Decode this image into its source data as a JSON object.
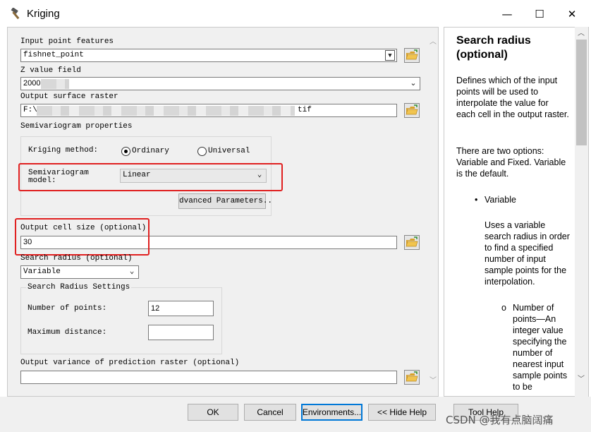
{
  "window": {
    "title": "Kriging",
    "minimize_glyph": "—",
    "maximize_glyph": "☐",
    "close_glyph": "✕"
  },
  "form": {
    "input_point_features": {
      "label": "Input point features",
      "value": "fishnet_point"
    },
    "z_value_field": {
      "label": "Z value field",
      "value": "2000"
    },
    "output_surface_raster": {
      "label": "Output surface raster",
      "value_prefix": "F:\\",
      "value_suffix": "tif"
    },
    "semivariogram_properties": {
      "label": "Semivariogram properties",
      "kriging_method_label": "Kriging method:",
      "ordinary_label": "Ordinary",
      "universal_label": "Universal",
      "selected_method": "Ordinary",
      "model_label_line1": "Semivariogram",
      "model_label_line2": "model:",
      "model_value": "Linear",
      "advanced_button": "dvanced Parameters.."
    },
    "output_cell_size": {
      "label": "Output cell size (optional)",
      "value": "30"
    },
    "search_radius": {
      "label": "Search radius (optional)",
      "value": "Variable",
      "settings_label": "Search Radius Settings",
      "number_of_points_label": "Number of points:",
      "number_of_points_value": "12",
      "maximum_distance_label": "Maximum distance:",
      "maximum_distance_value": ""
    },
    "output_variance": {
      "label": "Output variance of prediction raster (optional)",
      "value": ""
    }
  },
  "help": {
    "title": "Search radius (optional)",
    "para1": "Defines which of the input points will be used to interpolate the value for each cell in the output raster.",
    "para2": "There are two options: Variable and Fixed. Variable is the default.",
    "bullet1": "Variable",
    "para3": "Uses a variable search radius in order to find a specified number of input sample points for the interpolation.",
    "sub_bullet": "Number of points—An integer value specifying the number of nearest input sample points to be"
  },
  "buttons": {
    "ok": "OK",
    "cancel": "Cancel",
    "environments": "Environments...",
    "hide_help": "<< Hide Help",
    "tool_help": "Tool Help"
  },
  "watermark": "CSDN @我有点脑阔痛",
  "colors": {
    "highlight_box": "#e02020",
    "folder_icon": "#e8b53a",
    "plus_icon": "#2e8b2e"
  }
}
